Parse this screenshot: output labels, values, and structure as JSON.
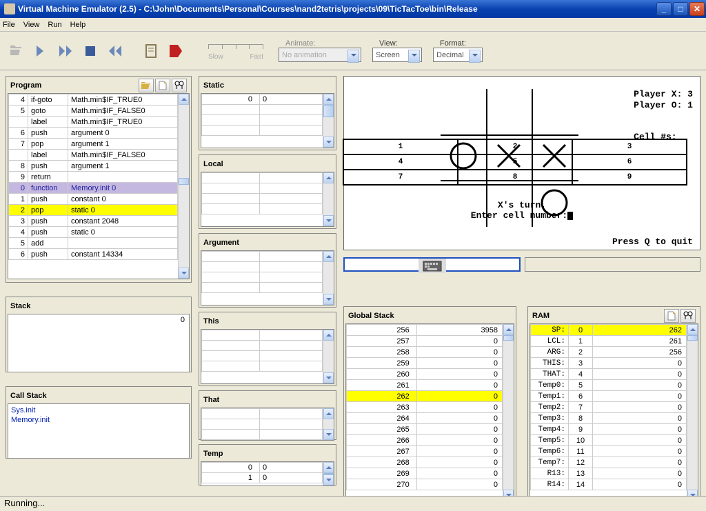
{
  "title": "Virtual Machine Emulator (2.5) - C:\\John\\Documents\\Personal\\Courses\\nand2tetris\\projects\\09\\TicTacToe\\bin\\Release",
  "menu": {
    "file": "File",
    "view": "View",
    "run": "Run",
    "help": "Help"
  },
  "toolbar": {
    "slow": "Slow",
    "fast": "Fast",
    "animate": "Animate:",
    "view": "View:",
    "format": "Format:",
    "anim_val": "No animation",
    "view_val": "Screen",
    "format_val": "Decimal"
  },
  "program": {
    "title": "Program",
    "rows": [
      {
        "n": "4",
        "op": "if-goto",
        "arg": "Math.min$IF_TRUE0"
      },
      {
        "n": "5",
        "op": "goto",
        "arg": "Math.min$IF_FALSE0"
      },
      {
        "n": "",
        "op": "label",
        "arg": "Math.min$IF_TRUE0"
      },
      {
        "n": "6",
        "op": "push",
        "arg": "argument 0"
      },
      {
        "n": "7",
        "op": "pop",
        "arg": "argument 1"
      },
      {
        "n": "",
        "op": "label",
        "arg": "Math.min$IF_FALSE0"
      },
      {
        "n": "8",
        "op": "push",
        "arg": "argument 1"
      },
      {
        "n": "9",
        "op": "return",
        "arg": ""
      },
      {
        "n": "0",
        "op": "function",
        "arg": "Memory.init 0",
        "cls": "purple"
      },
      {
        "n": "1",
        "op": "push",
        "arg": "constant 0"
      },
      {
        "n": "2",
        "op": "pop",
        "arg": "static 0",
        "cls": "yellow"
      },
      {
        "n": "3",
        "op": "push",
        "arg": "constant 2048"
      },
      {
        "n": "4",
        "op": "push",
        "arg": "static 0"
      },
      {
        "n": "5",
        "op": "add",
        "arg": ""
      },
      {
        "n": "6",
        "op": "push",
        "arg": "constant 14334"
      }
    ]
  },
  "stack": {
    "title": "Stack",
    "val": "0"
  },
  "callstack": {
    "title": "Call Stack",
    "items": [
      "Sys.init",
      "Memory.init"
    ]
  },
  "segs": {
    "static": {
      "title": "Static",
      "rows": [
        [
          "0",
          "0"
        ],
        [
          "",
          ""
        ],
        [
          "",
          ""
        ],
        [
          "",
          ""
        ]
      ]
    },
    "local": {
      "title": "Local",
      "rows": [
        [
          "",
          ""
        ],
        [
          "",
          ""
        ],
        [
          "",
          ""
        ],
        [
          "",
          ""
        ]
      ]
    },
    "argument": {
      "title": "Argument",
      "rows": [
        [
          "",
          ""
        ],
        [
          "",
          ""
        ],
        [
          "",
          ""
        ],
        [
          "",
          ""
        ]
      ]
    },
    "this": {
      "title": "This",
      "rows": [
        [
          "",
          ""
        ],
        [
          "",
          ""
        ],
        [
          "",
          ""
        ],
        [
          "",
          ""
        ]
      ]
    },
    "that": {
      "title": "That",
      "rows": [
        [
          "",
          ""
        ],
        [
          "",
          ""
        ],
        [
          "",
          ""
        ]
      ]
    },
    "temp": {
      "title": "Temp",
      "rows": [
        [
          "0",
          "0"
        ],
        [
          "1",
          "0"
        ]
      ]
    }
  },
  "screen": {
    "px": "Player X: 3",
    "po": "Player O: 1",
    "cellhdr": "Cell #s:",
    "turn": "X's turn.",
    "enter": "Enter cell number:",
    "quit": "Press Q to quit"
  },
  "gstack": {
    "title": "Global Stack",
    "rows": [
      [
        "256",
        "3958"
      ],
      [
        "257",
        "0"
      ],
      [
        "258",
        "0"
      ],
      [
        "259",
        "0"
      ],
      [
        "260",
        "0"
      ],
      [
        "261",
        "0"
      ],
      [
        "262",
        "0"
      ],
      [
        "263",
        "0"
      ],
      [
        "264",
        "0"
      ],
      [
        "265",
        "0"
      ],
      [
        "266",
        "0"
      ],
      [
        "267",
        "0"
      ],
      [
        "268",
        "0"
      ],
      [
        "269",
        "0"
      ],
      [
        "270",
        "0"
      ]
    ]
  },
  "ram": {
    "title": "RAM",
    "rows": [
      {
        "k": "SP:",
        "a": "0",
        "v": "262",
        "hl": true
      },
      {
        "k": "LCL:",
        "a": "1",
        "v": "261"
      },
      {
        "k": "ARG:",
        "a": "2",
        "v": "256"
      },
      {
        "k": "THIS:",
        "a": "3",
        "v": "0"
      },
      {
        "k": "THAT:",
        "a": "4",
        "v": "0"
      },
      {
        "k": "Temp0:",
        "a": "5",
        "v": "0"
      },
      {
        "k": "Temp1:",
        "a": "6",
        "v": "0"
      },
      {
        "k": "Temp2:",
        "a": "7",
        "v": "0"
      },
      {
        "k": "Temp3:",
        "a": "8",
        "v": "0"
      },
      {
        "k": "Temp4:",
        "a": "9",
        "v": "0"
      },
      {
        "k": "Temp5:",
        "a": "10",
        "v": "0"
      },
      {
        "k": "Temp6:",
        "a": "11",
        "v": "0"
      },
      {
        "k": "Temp7:",
        "a": "12",
        "v": "0"
      },
      {
        "k": "R13:",
        "a": "13",
        "v": "0"
      },
      {
        "k": "R14:",
        "a": "14",
        "v": "0"
      }
    ]
  },
  "status": "Running..."
}
